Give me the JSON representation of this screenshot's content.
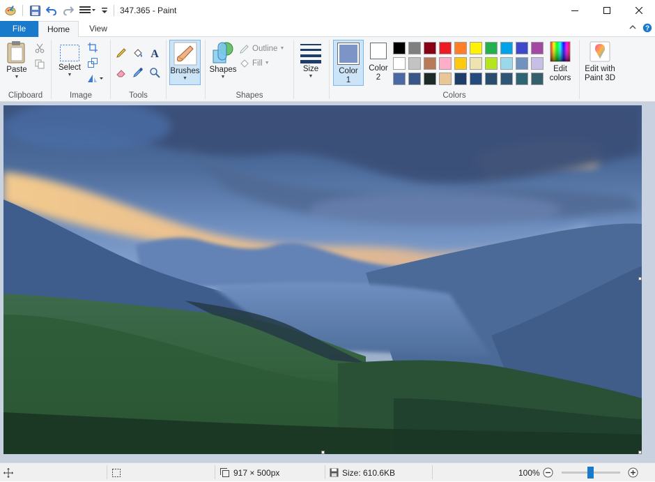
{
  "window": {
    "title": "347.365 - Paint"
  },
  "tabs": {
    "file": "File",
    "home": "Home",
    "view": "View"
  },
  "ribbon": {
    "clipboard": {
      "paste": "Paste",
      "group_label": "Clipboard"
    },
    "image": {
      "select": "Select",
      "group_label": "Image"
    },
    "tools": {
      "group_label": "Tools"
    },
    "brushes": {
      "label": "Brushes"
    },
    "shapes": {
      "shapes": "Shapes",
      "outline": "Outline",
      "fill": "Fill",
      "group_label": "Shapes"
    },
    "size": {
      "label": "Size"
    },
    "colors": {
      "color1_label": "Color",
      "color1_num": "1",
      "color2_label": "Color",
      "color2_num": "2",
      "color1_value": "#7c95c6",
      "color2_value": "#ffffff",
      "edit_colors_line1": "Edit",
      "edit_colors_line2": "colors",
      "group_label": "Colors",
      "palette_row1": [
        "#000000",
        "#7f7f7f",
        "#880015",
        "#ed1c24",
        "#ff7f27",
        "#fff200",
        "#22b14c",
        "#00a2e8",
        "#3f48cc",
        "#a349a4"
      ],
      "palette_row2": [
        "#ffffff",
        "#c3c3c3",
        "#b97a57",
        "#ffaec9",
        "#ffc90e",
        "#efe4b0",
        "#b5e61d",
        "#99d9ea",
        "#7092be",
        "#c8bfe7"
      ],
      "palette_row3": [
        "#4b69a3",
        "#3a5587",
        "#1d2a2a",
        "#e9c795",
        "#1f3d6b",
        "#264a7e",
        "#2a4d6e",
        "#2f5775",
        "#2f6572",
        "#365f6d"
      ]
    },
    "paint3d": {
      "line1": "Edit with",
      "line2": "Paint 3D"
    }
  },
  "status": {
    "dimensions": "917 × 500px",
    "size": "Size: 610.6KB",
    "zoom": "100%",
    "zoom_level": 100
  }
}
